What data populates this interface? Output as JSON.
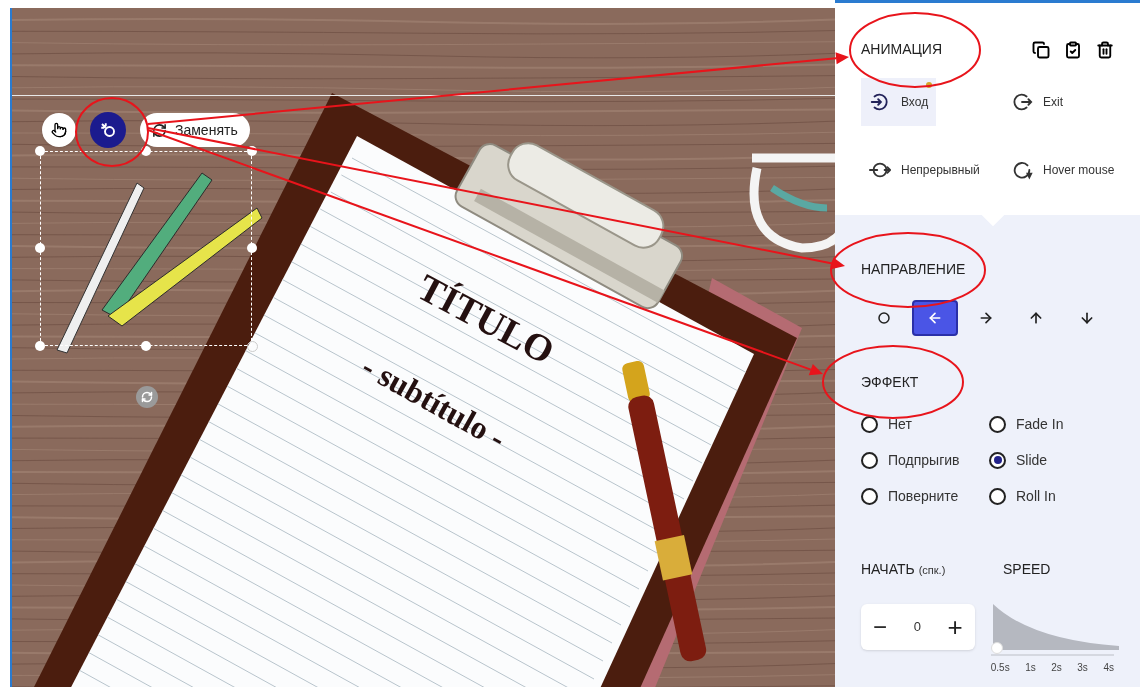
{
  "canvas": {
    "title": "TÍTULO",
    "subtitle": "- subtítulo -",
    "toolbar": {
      "animate_selected": true,
      "replace_label": "Заменять"
    }
  },
  "panel": {
    "title": "АНИМАЦИЯ",
    "animation_types": [
      {
        "kind": "enter",
        "label": "Вход",
        "selected": true,
        "marked": true
      },
      {
        "kind": "exit",
        "label": "Exit",
        "selected": false,
        "marked": false
      },
      {
        "kind": "loop",
        "label": "Непрерывный",
        "selected": false,
        "marked": false
      },
      {
        "kind": "hover",
        "label": "Hover mouse",
        "selected": false,
        "marked": false
      }
    ],
    "direction": {
      "title": "НАПРАВЛЕНИЕ",
      "options": [
        {
          "kind": "none",
          "selected": false
        },
        {
          "kind": "left",
          "selected": true
        },
        {
          "kind": "right",
          "selected": false
        },
        {
          "kind": "up",
          "selected": false
        },
        {
          "kind": "down",
          "selected": false
        }
      ]
    },
    "effect": {
      "title": "ЭФФЕКТ",
      "options": [
        {
          "label": "Нет",
          "selected": false
        },
        {
          "label": "Fade In",
          "selected": false
        },
        {
          "label": "Подпрыгив",
          "selected": false
        },
        {
          "label": "Slide",
          "selected": true
        },
        {
          "label": "Поверните",
          "selected": false
        },
        {
          "label": "Roll In",
          "selected": false
        }
      ]
    },
    "start": {
      "label": "НАЧАТЬ",
      "unit": "(спк.)",
      "value": "0",
      "minus": "−",
      "plus": "+"
    },
    "speed": {
      "label": "SPEED",
      "level": 0,
      "ticks": [
        "0.5s",
        "1s",
        "2s",
        "3s",
        "4s"
      ]
    }
  }
}
